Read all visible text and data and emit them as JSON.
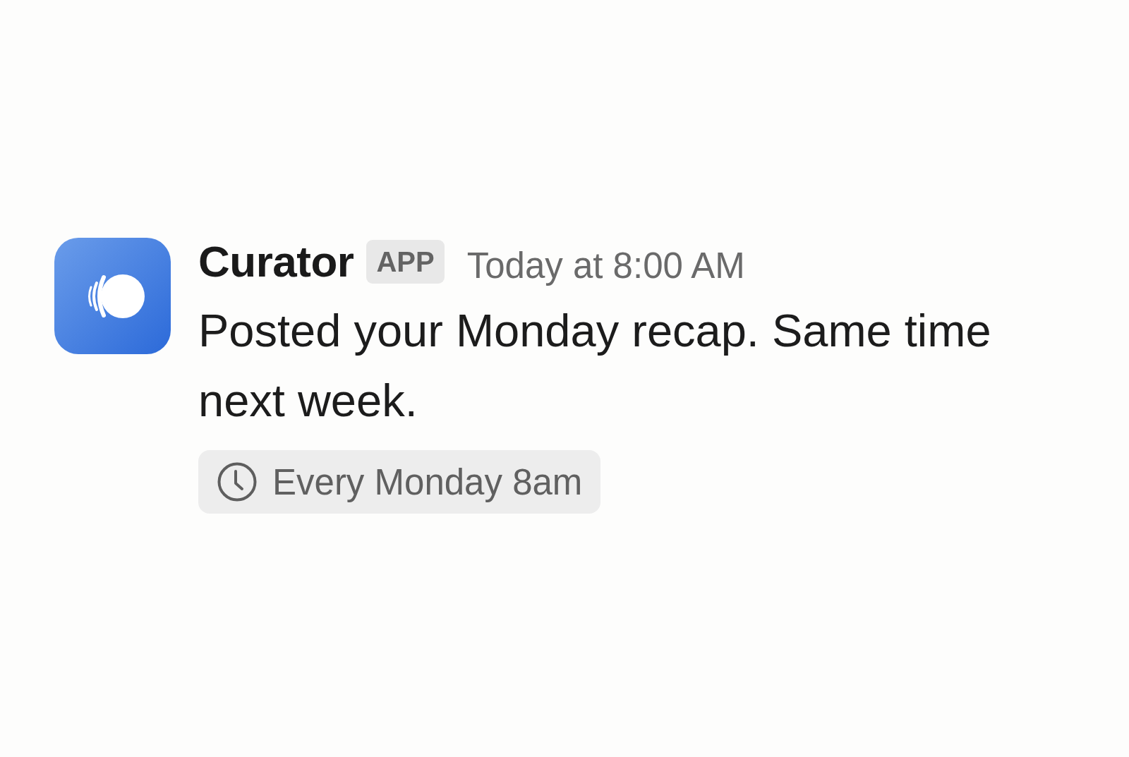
{
  "message": {
    "sender": "Curator",
    "badge": "APP",
    "timestamp": "Today at 8:00 AM",
    "text": "Posted your Monday recap. Same time next week.",
    "schedule": "Every Monday 8am"
  }
}
